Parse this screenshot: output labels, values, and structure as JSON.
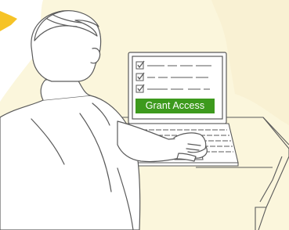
{
  "illustration": {
    "subject": "person-at-laptop",
    "checklist_items": 3,
    "button_label": "Grant Access"
  },
  "colors": {
    "background_blob": "#fbf6dc",
    "accent_yellow": "#f6c327",
    "button_green": "#3d9a1d",
    "button_text": "#ffffff",
    "line_art": "#5a5a5a",
    "screen_fill": "#ffffff"
  }
}
